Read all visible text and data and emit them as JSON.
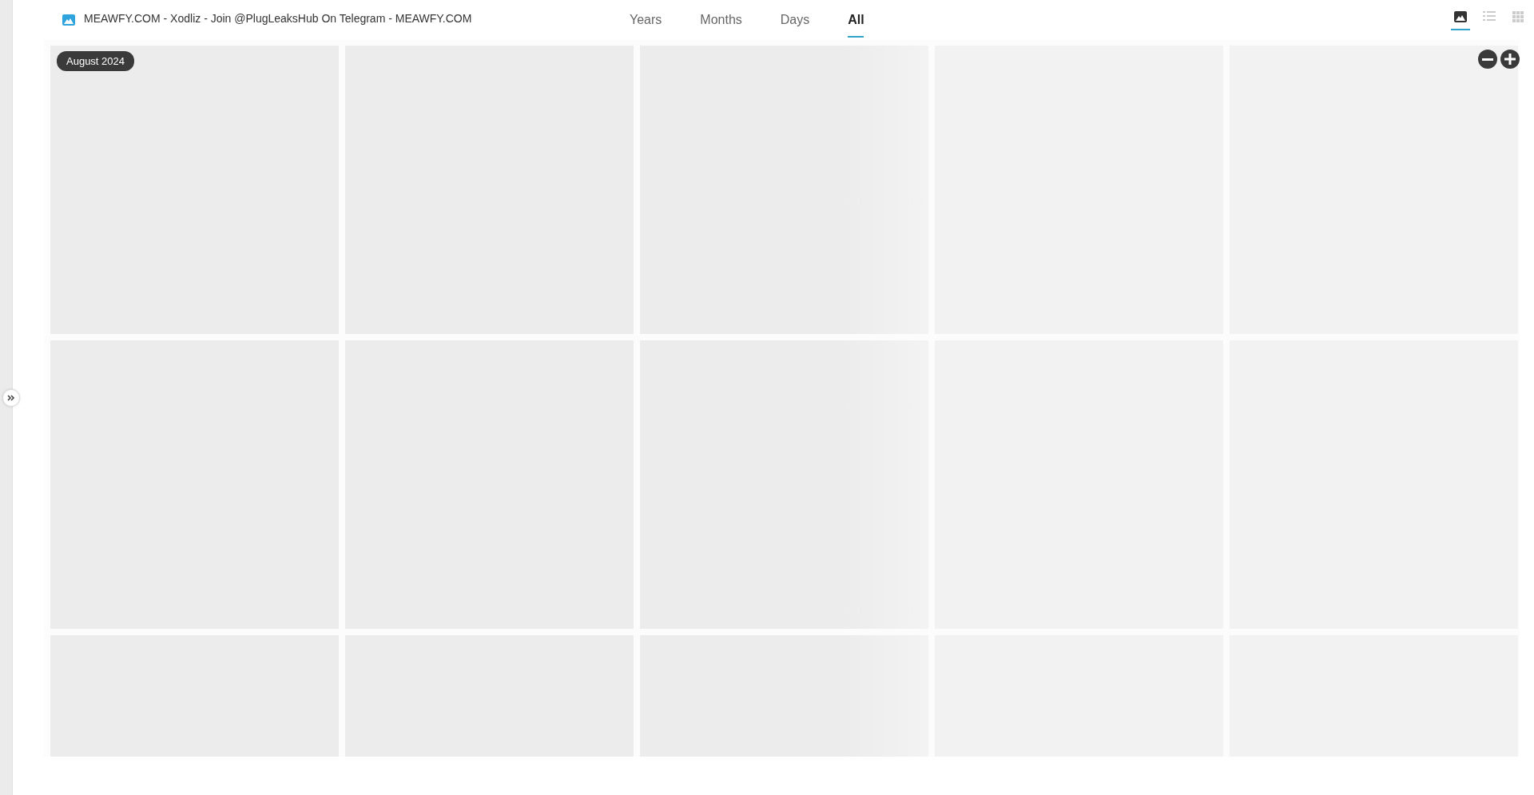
{
  "album": {
    "title": "MEAWFY.COM - Xodliz - Join @PlugLeaksHub On Telegram - MEAWFY.COM"
  },
  "tabs": [
    {
      "label": "Years",
      "selected": false
    },
    {
      "label": "Months",
      "selected": false
    },
    {
      "label": "Days",
      "selected": false
    },
    {
      "label": "All",
      "selected": true
    }
  ],
  "view_modes": [
    {
      "kind": "photo",
      "selected": true
    },
    {
      "kind": "list",
      "selected": false
    },
    {
      "kind": "grid",
      "selected": false
    }
  ],
  "date_chip": "August 2024"
}
